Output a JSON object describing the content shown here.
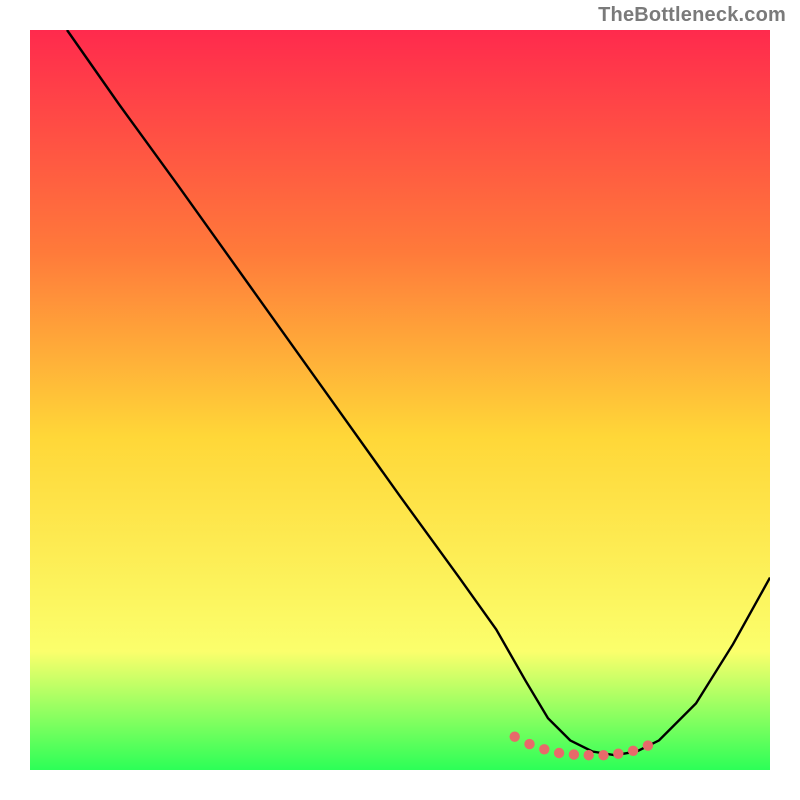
{
  "watermark": "TheBottleneck.com",
  "colors": {
    "gradient_top": "#ff2a4d",
    "gradient_mid_upper": "#ff7a3a",
    "gradient_mid": "#ffd738",
    "gradient_mid_lower": "#fbff6c",
    "gradient_bottom": "#2cff57",
    "curve": "#000000",
    "marker": "#e86a6a",
    "frame": "#ffffff"
  },
  "chart_data": {
    "type": "line",
    "title": "",
    "xlabel": "",
    "ylabel": "",
    "x": [
      0.05,
      0.12,
      0.2,
      0.3,
      0.4,
      0.5,
      0.58,
      0.63,
      0.67,
      0.7,
      0.73,
      0.76,
      0.79,
      0.82,
      0.85,
      0.9,
      0.95,
      1.0
    ],
    "y": [
      1.0,
      0.9,
      0.79,
      0.65,
      0.51,
      0.37,
      0.26,
      0.19,
      0.12,
      0.07,
      0.04,
      0.025,
      0.02,
      0.025,
      0.04,
      0.09,
      0.17,
      0.26
    ],
    "xlim": [
      0,
      1
    ],
    "ylim": [
      0,
      1
    ],
    "markers": {
      "x": [
        0.655,
        0.675,
        0.695,
        0.715,
        0.735,
        0.755,
        0.775,
        0.795,
        0.815,
        0.835
      ],
      "y": [
        0.045,
        0.035,
        0.028,
        0.023,
        0.021,
        0.02,
        0.02,
        0.022,
        0.026,
        0.033
      ]
    },
    "annotations": []
  }
}
